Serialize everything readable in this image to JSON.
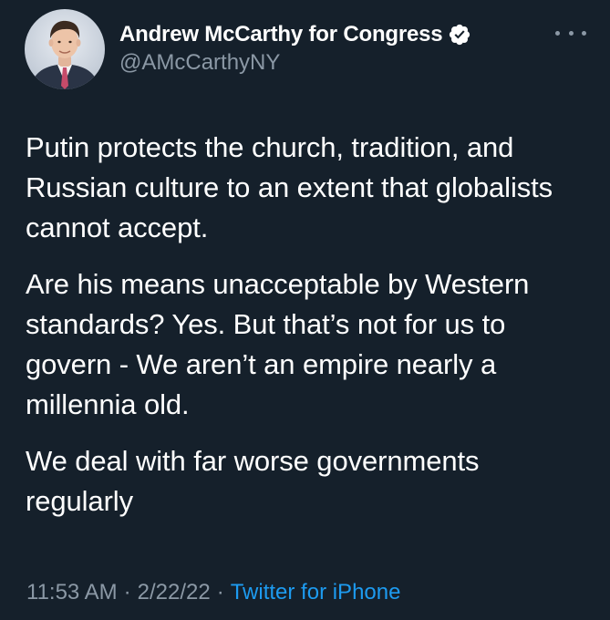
{
  "author": {
    "display_name": "Andrew McCarthy for Congress",
    "handle": "@AMcCarthyNY",
    "verified": true,
    "verified_badge_icon": "verified-badge-icon",
    "avatar_icon": "profile-avatar"
  },
  "tweet": {
    "paragraphs": [
      "Putin protects the church, tradition, and Russian culture to an extent that globalists cannot accept.",
      "Are his means unacceptable by Western standards? Yes. But that’s not for us to govern - We aren’t an empire nearly a millennia old.",
      "We deal with far worse governments regularly"
    ]
  },
  "meta": {
    "time": "11:53 AM",
    "separator": "·",
    "date": "2/22/22",
    "source": "Twitter for iPhone"
  },
  "colors": {
    "background": "#15202b",
    "text_primary": "#ffffff",
    "text_secondary": "#8b98a5",
    "link": "#1d9bf0",
    "verified_badge": "#ffffff"
  }
}
